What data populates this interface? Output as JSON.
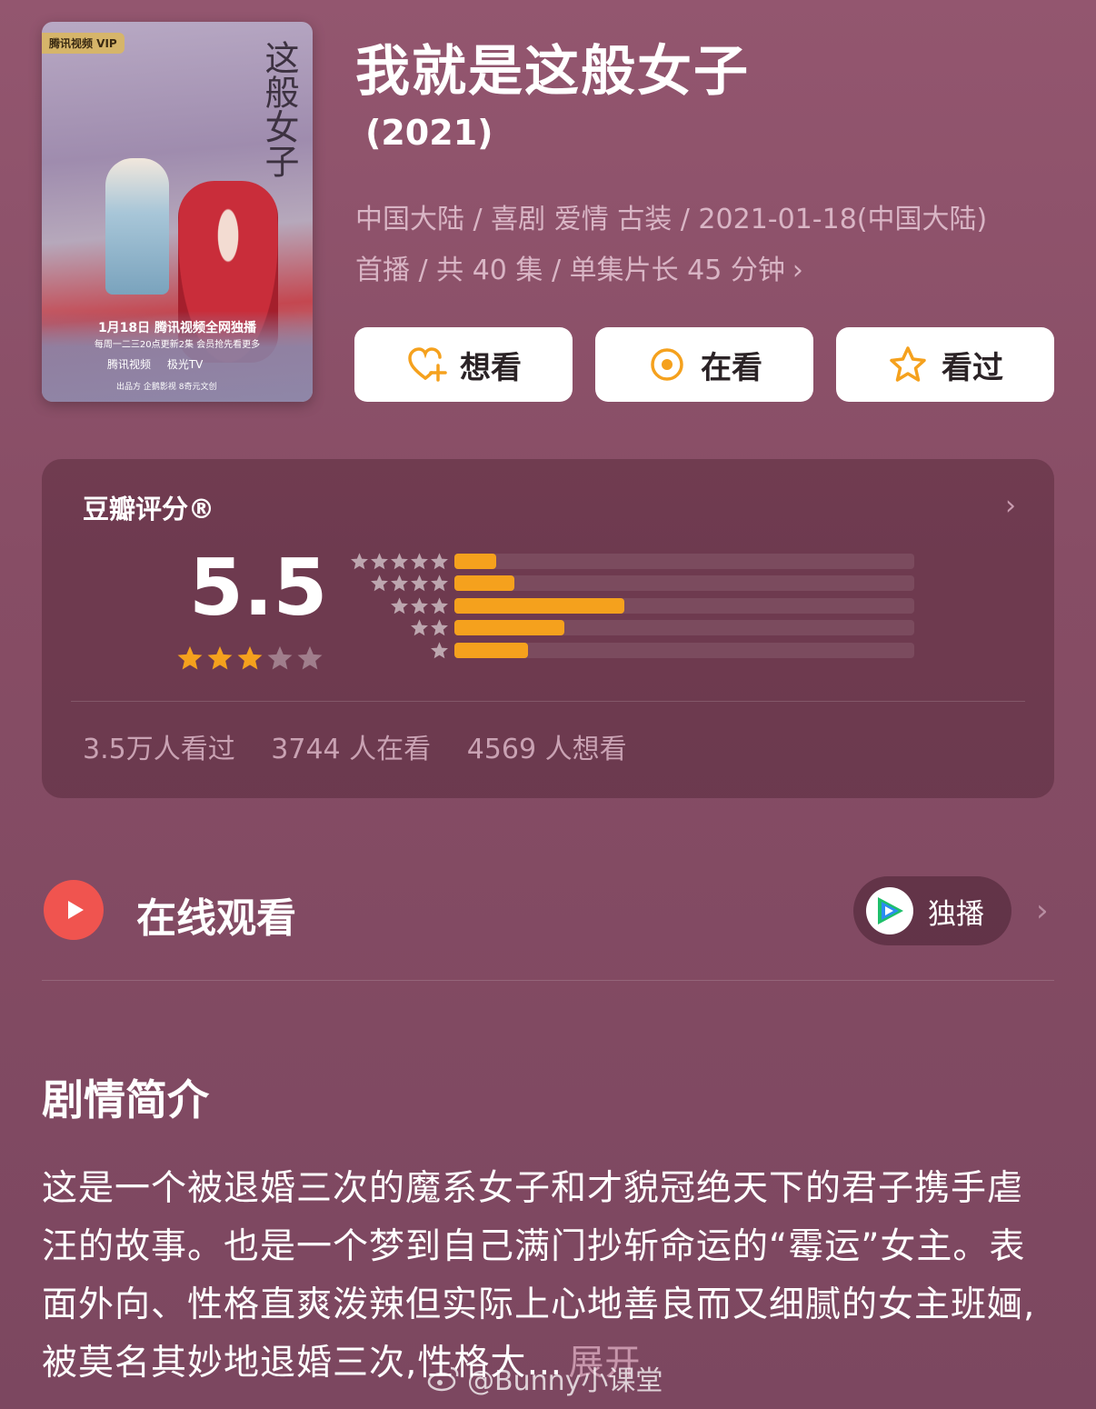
{
  "poster": {
    "vip_badge": "腾讯视频 VIP",
    "title_art": "这般女子",
    "release_line": "1月18日 腾讯视频全网独播",
    "update_line": "每周一二三20点更新2集 会员抢先看更多",
    "platform1": "腾讯视频",
    "platform2": "极光TV",
    "credits": "出品方  企鹅影视  8奇元文创"
  },
  "header": {
    "title": "我就是这般女子",
    "year": "(2021)",
    "meta_line1": "中国大陆 / 喜剧 爱情 古装 / 2021-01-18(中国大陆)",
    "meta_line2": "首播 / 共 40 集 / 单集片长 45 分钟"
  },
  "actions": {
    "want": "想看",
    "watching": "在看",
    "watched": "看过"
  },
  "rating": {
    "label": "豆瓣评分®",
    "score": "5.5",
    "stars_filled": 3,
    "stars_total": 5,
    "distribution": [
      {
        "stars": 5,
        "fraction": 0.09
      },
      {
        "stars": 4,
        "fraction": 0.13
      },
      {
        "stars": 3,
        "fraction": 0.37
      },
      {
        "stars": 2,
        "fraction": 0.24
      },
      {
        "stars": 1,
        "fraction": 0.16
      }
    ],
    "watched_count": "3.5万人看过",
    "watching_count": "3744 人在看",
    "want_count": "4569 人想看"
  },
  "online": {
    "label": "在线观看",
    "exclusive": "独播"
  },
  "synopsis": {
    "heading": "剧情简介",
    "text": "这是一个被退婚三次的魔系女子和才貌冠绝天下的君子携手虐汪的故事。也是一个梦到自己满门抄斩命运的“霉运”女主。表面外向、性格直爽泼辣但实际上心地善良而又细腻的女主班婳,被莫名其妙地退婚三次,性格大…",
    "expand": "展开"
  },
  "watermark": "@Bunny小课堂",
  "colors": {
    "accent_orange": "#f5a11d",
    "play_red": "#f0544f",
    "background": "#874d65"
  }
}
